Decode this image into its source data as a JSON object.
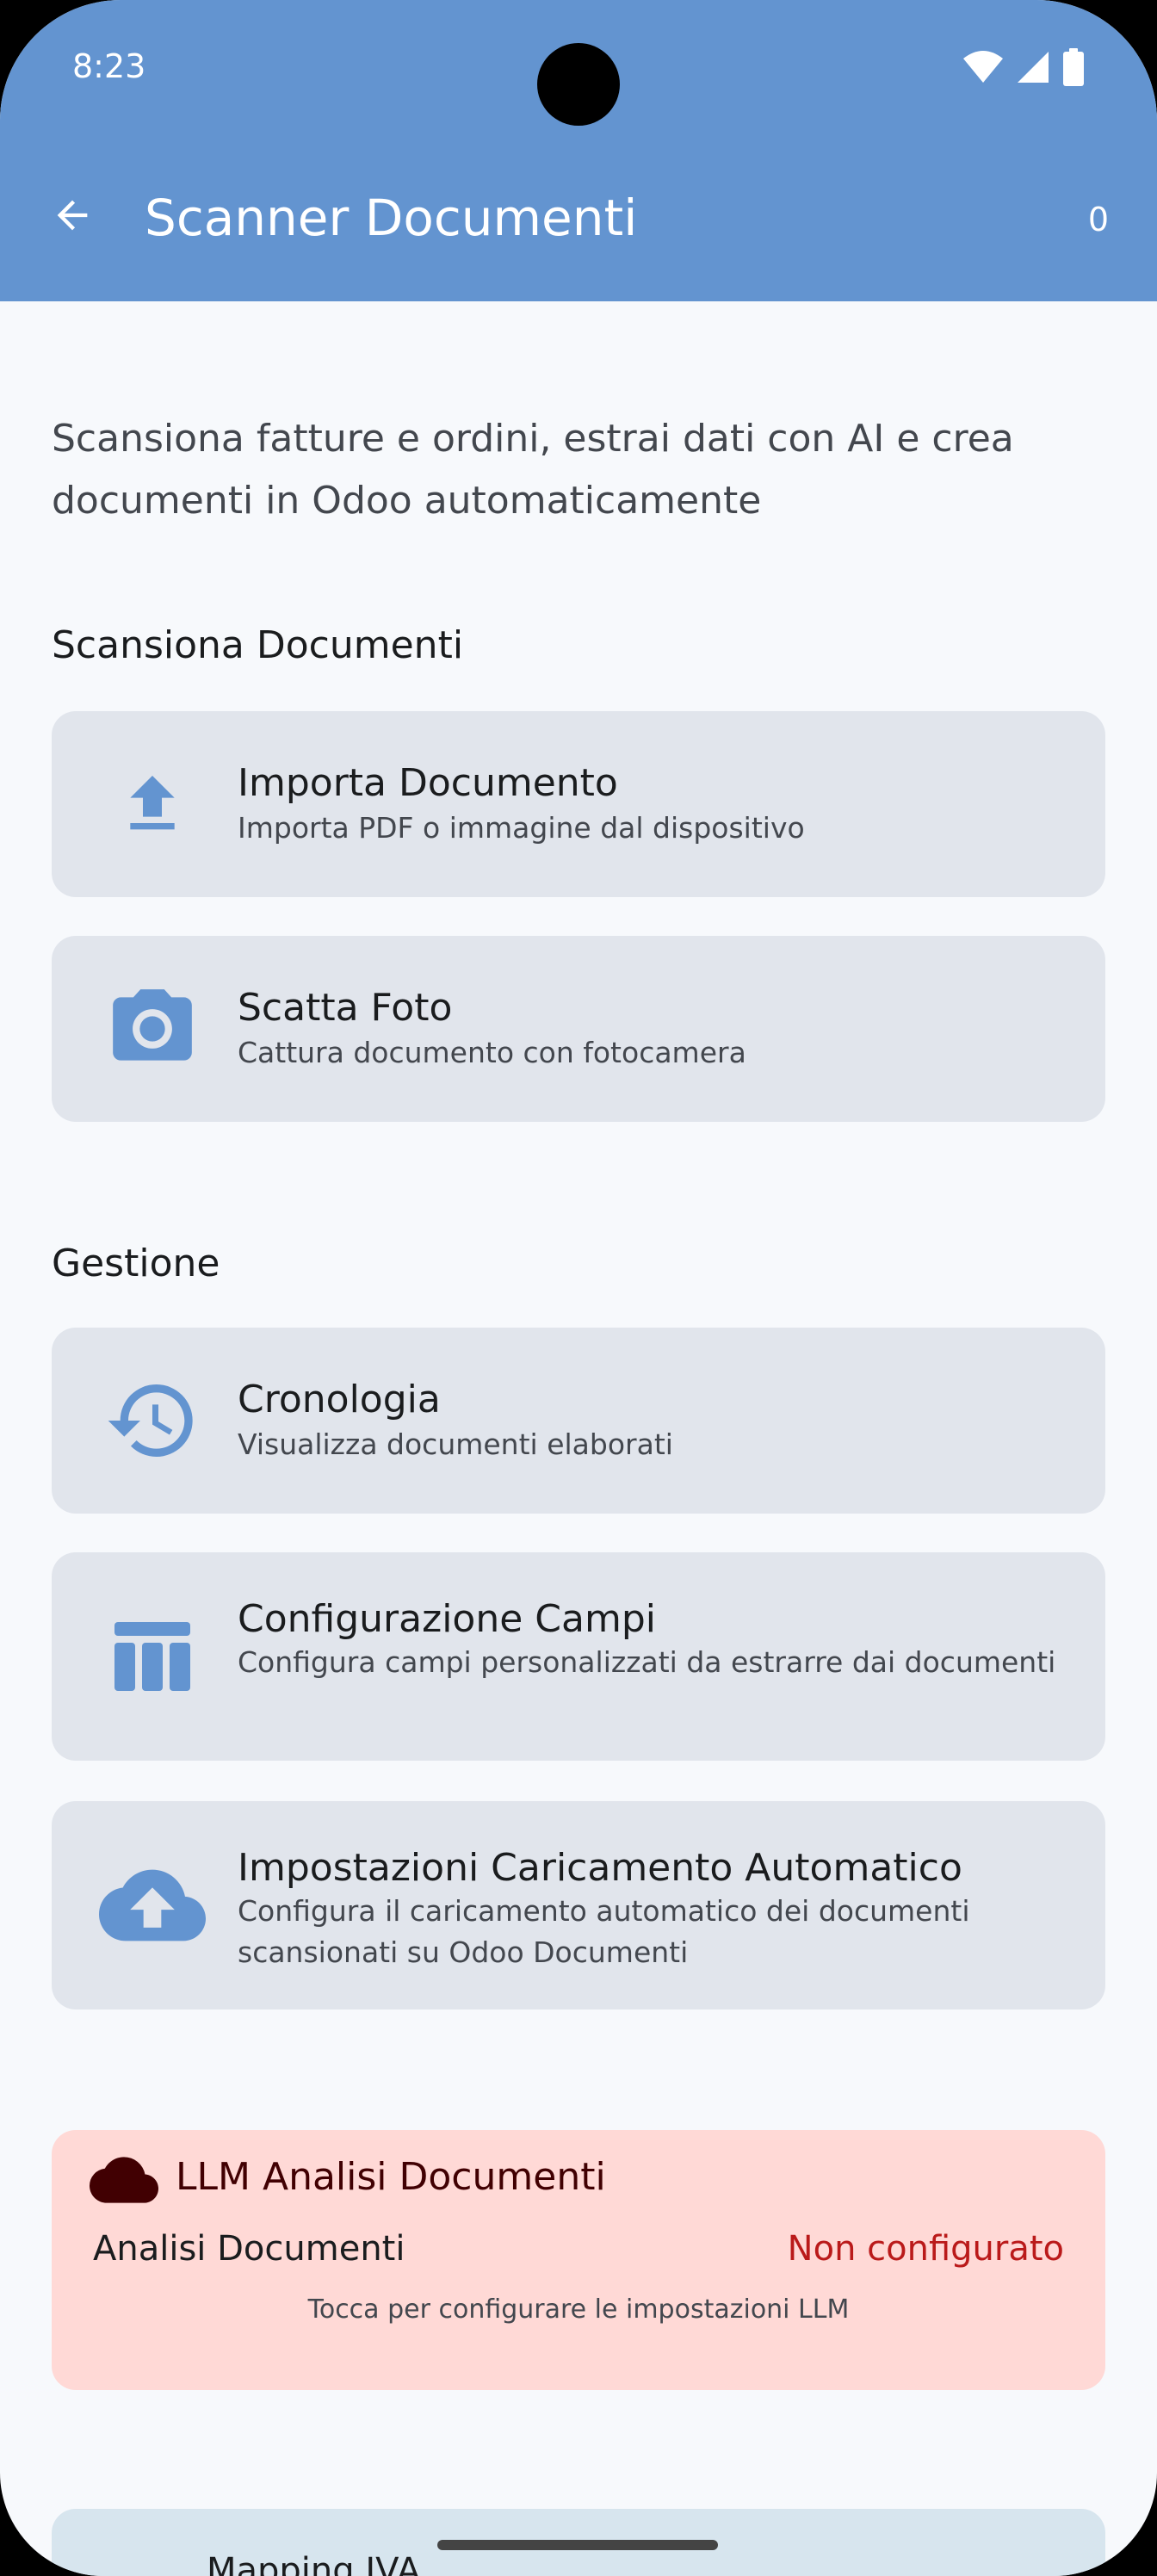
{
  "status_bar": {
    "time": "8:23"
  },
  "app_bar": {
    "title": "Scanner Documenti",
    "count": "0",
    "color": "#6394D0"
  },
  "intro": "Scansiona fatture e ordini, estrai dati con AI e crea documenti in Odoo automaticamente",
  "scan_section": {
    "title": "Scansiona Documenti",
    "items": [
      {
        "icon": "upload-icon",
        "title": "Importa Documento",
        "subtitle": "Importa PDF o immagine dal dispositivo"
      },
      {
        "icon": "camera-icon",
        "title": "Scatta Foto",
        "subtitle": "Cattura documento con fotocamera"
      }
    ]
  },
  "manage_section": {
    "title": "Gestione",
    "items": [
      {
        "icon": "history-icon",
        "title": "Cronologia",
        "subtitle": "Visualizza documenti elaborati"
      },
      {
        "icon": "table-icon",
        "title": "Configurazione Campi",
        "subtitle": "Configura campi personalizzati da estrarre dai documenti"
      },
      {
        "icon": "cloud-upload-icon",
        "title": "Impostazioni Caricamento Automatico",
        "subtitle": "Configura il caricamento automatico dei documenti scansionati su Odoo Documenti"
      }
    ]
  },
  "llm_card": {
    "icon": "cloud-icon",
    "title": "LLM Analisi Documenti",
    "label": "Analisi Documenti",
    "status": "Non configurato",
    "hint": "Tocca per configurare le impostazioni LLM",
    "status_color": "#BA1A1A"
  },
  "next_card": {
    "title": "Mapping IVA"
  },
  "colors": {
    "icon_accent": "#6394D0",
    "card_bg": "#E1E5EC",
    "page_bg": "#F7F9FC"
  }
}
